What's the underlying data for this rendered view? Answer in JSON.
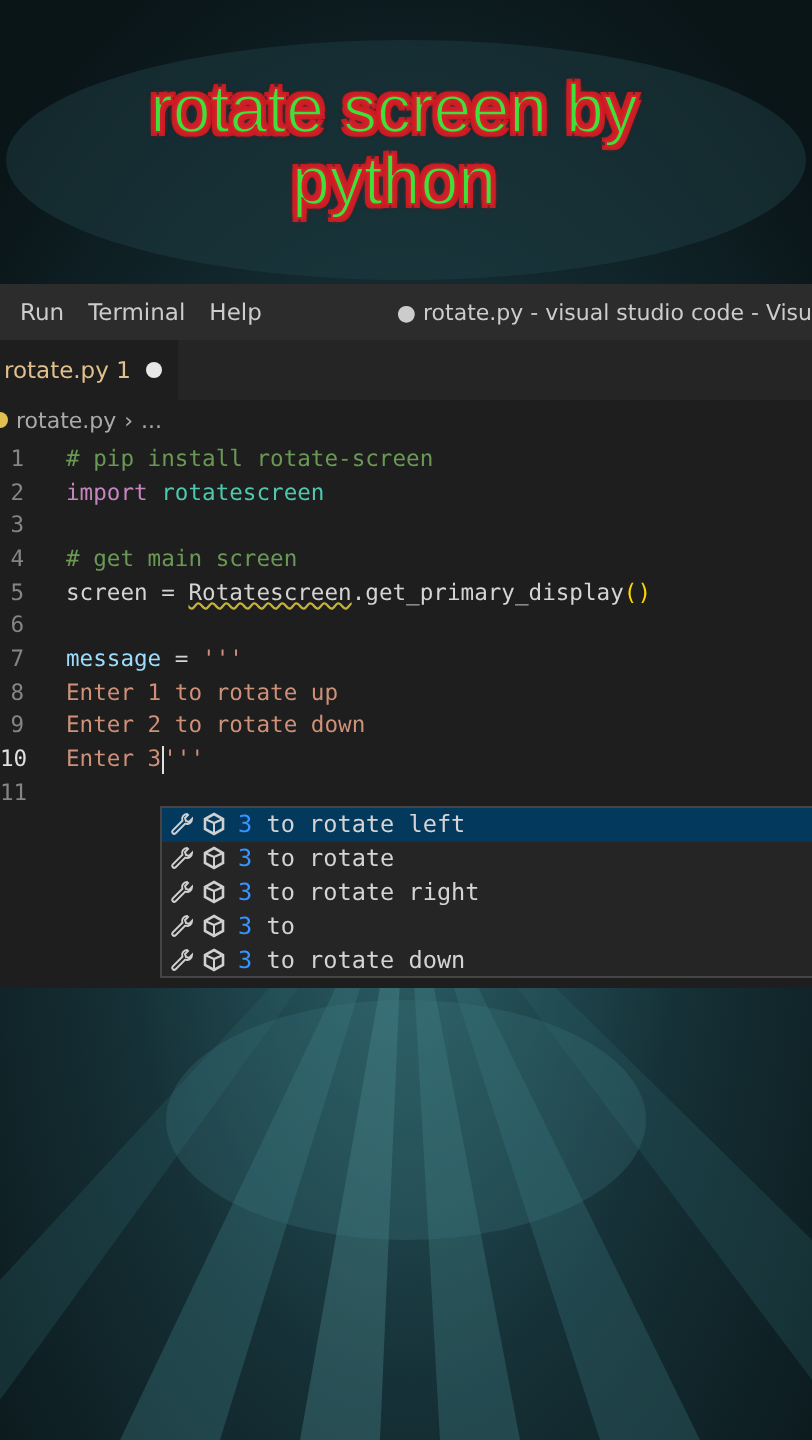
{
  "caption": [
    "rotate screen by",
    "python"
  ],
  "menu": [
    "Run",
    "Terminal",
    "Help"
  ],
  "window": {
    "title": "● rotate.py - visual studio code - Visu"
  },
  "tab": {
    "label": "rotate.py 1",
    "dirty": true
  },
  "breadcrumb": [
    "rotate.py",
    "›",
    "..."
  ],
  "code_lines": [
    {
      "number": "1",
      "current": false,
      "tokens": [
        {
          "text": "# pip install rotate-screen",
          "kind": "comment"
        }
      ]
    },
    {
      "number": "2",
      "current": false,
      "tokens": [
        {
          "text": "import",
          "kind": "keyword"
        },
        {
          "text": "rotatescreen",
          "kind": "module",
          "spaced": true
        }
      ]
    },
    {
      "number": "3",
      "current": false
    },
    {
      "number": "4",
      "current": false,
      "tokens": [
        {
          "text": "# get main screen",
          "kind": "comment"
        }
      ]
    },
    {
      "number": "5",
      "current": false,
      "tokens": [
        {
          "text": "screen",
          "kind": "plain"
        },
        {
          "text": " = ",
          "kind": "plain"
        },
        {
          "text": "Rotatescreen",
          "kind": "warned"
        },
        {
          "text": ".",
          "kind": "plain"
        },
        {
          "text": "get_primary_display",
          "kind": "plain"
        },
        {
          "text": "()",
          "kind": "bracket"
        }
      ]
    },
    {
      "number": "6",
      "current": false
    },
    {
      "number": "7",
      "current": false,
      "tokens": [
        {
          "text": "message",
          "kind": "variable"
        },
        {
          "text": " = ",
          "kind": "plain"
        },
        {
          "text": "'''",
          "kind": "string"
        }
      ]
    },
    {
      "number": "8",
      "current": false,
      "tokens": [
        {
          "text": "Enter 1 to rotate up",
          "kind": "string"
        }
      ]
    },
    {
      "number": "9",
      "current": false,
      "tokens": [
        {
          "text": "Enter 2 to rotate down",
          "kind": "string"
        }
      ]
    },
    {
      "number": "10",
      "current": true,
      "tokens": [
        {
          "text": "Enter 3",
          "kind": "string"
        },
        {
          "kind": "cursor"
        },
        {
          "text": "'''",
          "kind": "string"
        }
      ]
    },
    {
      "number": "11",
      "current": false
    }
  ],
  "suggestions": [
    {
      "match": "3",
      "rest": " to rotate left",
      "selected": true
    },
    {
      "match": "3",
      "rest": " to rotate",
      "selected": false
    },
    {
      "match": "3",
      "rest": " to rotate right",
      "selected": false
    },
    {
      "match": "3",
      "rest": " to",
      "selected": false
    },
    {
      "match": "3",
      "rest": " to rotate down",
      "selected": false
    }
  ]
}
